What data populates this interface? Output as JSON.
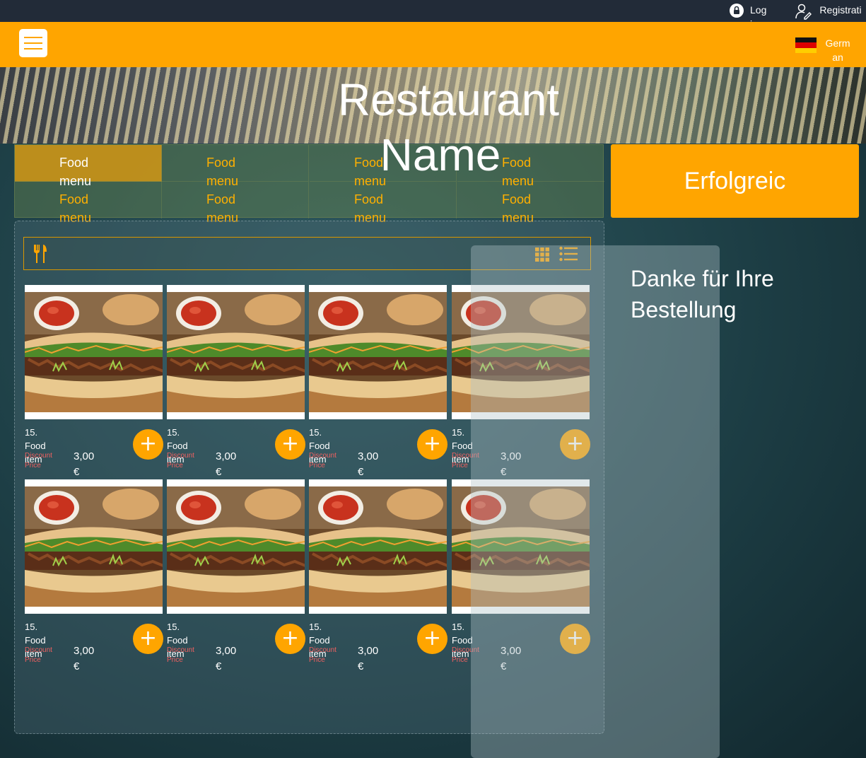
{
  "top_bar": {
    "login_label": "Login",
    "register_label": "Registration"
  },
  "nav": {
    "language_label": "German"
  },
  "hero": {
    "title": "Restaurant Name"
  },
  "categories": [
    {
      "label": "Food menu"
    },
    {
      "label": "Food menu"
    },
    {
      "label": "Food menu"
    },
    {
      "label": "Food menu"
    },
    {
      "label": "Food menu"
    },
    {
      "label": "Food menu"
    },
    {
      "label": "Food menu"
    },
    {
      "label": "Food menu"
    }
  ],
  "order_status": {
    "title": "Erfolgreic",
    "message": "Danke für Ihre Bestellung"
  },
  "products": [
    {
      "name": "15. Food item",
      "discount_label": "Discount Price",
      "price": "3,00 €",
      "add_label": "+"
    },
    {
      "name": "15. Food item",
      "discount_label": "Discount Price",
      "price": "3,00 €",
      "add_label": "+"
    },
    {
      "name": "15. Food item",
      "discount_label": "Discount Price",
      "price": "3,00 €",
      "add_label": "+"
    },
    {
      "name": "15. Food item",
      "discount_label": "Discount Price",
      "price": "3,00 €",
      "add_label": "+"
    },
    {
      "name": "15. Food item",
      "discount_label": "Discount Price",
      "price": "3,00 €",
      "add_label": "+"
    },
    {
      "name": "15. Food item",
      "discount_label": "Discount Price",
      "price": "3,00 €",
      "add_label": "+"
    },
    {
      "name": "15. Food item",
      "discount_label": "Discount Price",
      "price": "3,00 €",
      "add_label": "+"
    },
    {
      "name": "15. Food item",
      "discount_label": "Discount Price",
      "price": "3,00 €",
      "add_label": "+"
    }
  ],
  "icons": {
    "login": "lock-icon",
    "register": "user-edit-icon",
    "language": "german-flag-icon",
    "menu": "hamburger-icon",
    "category": "fork-knife-icon",
    "grid_view": "grid-icon",
    "list_view": "list-icon",
    "product_image": "sandwich-image",
    "add": "plus-icon"
  },
  "colors": {
    "accent": "#ffa500",
    "topbar": "#222b38",
    "discount_text": "#f06060",
    "category_text": "#ffb000"
  }
}
